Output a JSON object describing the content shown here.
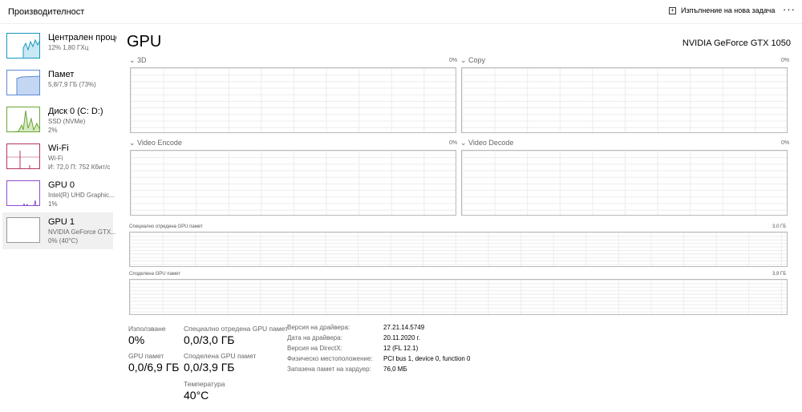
{
  "header": {
    "title": "Производителност",
    "new_task": "Изпълнение на нова задача",
    "more": "···"
  },
  "sidebar": {
    "items": [
      {
        "name": "Централен проце",
        "sub1": "12% 1,80 ГХц",
        "sub2": "",
        "color": "#1797c0"
      },
      {
        "name": "Памет",
        "sub1": "5,8/7,9 ГБ (73%)",
        "sub2": "",
        "color": "#5a8ad8"
      },
      {
        "name": "Диск 0 (C: D:)",
        "sub1": "SSD (NVMe)",
        "sub2": "2%",
        "color": "#6aa534"
      },
      {
        "name": "Wi-Fi",
        "sub1": "Wi-Fi",
        "sub2": "И: 72,0 П: 752 Кбит/с",
        "color": "#b0375b"
      },
      {
        "name": "GPU 0",
        "sub1": "Intel(R) UHD Graphic...",
        "sub2": "1%",
        "color": "#8b4fcf"
      },
      {
        "name": "GPU 1",
        "sub1": "NVIDIA GeForce GTX...",
        "sub2": "0% (40°C)",
        "color": "#999999"
      }
    ]
  },
  "main": {
    "title": "GPU",
    "model": "NVIDIA GeForce GTX 1050",
    "engines": [
      {
        "label": "3D",
        "pct": "0%"
      },
      {
        "label": "Copy",
        "pct": "0%"
      },
      {
        "label": "Video Encode",
        "pct": "0%"
      },
      {
        "label": "Video Decode",
        "pct": "0%"
      }
    ],
    "dedicated": {
      "label": "Специално отредена GPU памет",
      "max": "3,0 ГБ"
    },
    "shared": {
      "label": "Споделена GPU памет",
      "max": "3,9 ГБ"
    },
    "stats": {
      "usage_label": "Използване",
      "usage": "0%",
      "gpumem_label": "GPU памет",
      "gpumem": "0,0/6,9 ГБ",
      "ded_label": "Специално отредена GPU памет",
      "ded": "0,0/3,0 ГБ",
      "shared_label": "Споделена GPU памет",
      "shared": "0,0/3,9 ГБ",
      "temp_label": "Температура",
      "temp": "40°C"
    },
    "info": [
      {
        "k": "Версия на драйвера:",
        "v": "27.21.14.5749"
      },
      {
        "k": "Дата на драйвера:",
        "v": "20.11.2020 г."
      },
      {
        "k": "Версия на DirectX:",
        "v": "12 (FL 12.1)"
      },
      {
        "k": "Физическо местоположение:",
        "v": "PCI bus 1, device 0, function 0"
      },
      {
        "k": "Запазена памет на хардуер:",
        "v": "76,0 МБ"
      }
    ]
  }
}
